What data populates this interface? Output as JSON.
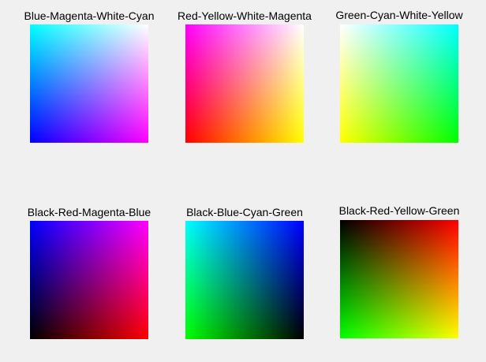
{
  "figure": {
    "background": "#f0f0f0",
    "panels": [
      {
        "title": "Blue-Magenta-White-Cyan",
        "corners": {
          "top_left": "#00ffff",
          "top_right": "#ffffff",
          "bottom_left": "#0000ff",
          "bottom_right": "#ff00ff"
        }
      },
      {
        "title": "Red-Yellow-White-Magenta",
        "corners": {
          "top_left": "#ff00ff",
          "top_right": "#ffffff",
          "bottom_left": "#ff0000",
          "bottom_right": "#ffff00"
        }
      },
      {
        "title": "Green-Cyan-White-Yellow",
        "corners": {
          "top_left": "#ffffff",
          "top_right": "#00ffff",
          "bottom_left": "#ffff00",
          "bottom_right": "#00ff00"
        }
      },
      {
        "title": "Black-Red-Magenta-Blue",
        "corners": {
          "top_left": "#0000ff",
          "top_right": "#ff00ff",
          "bottom_left": "#000000",
          "bottom_right": "#ff0000"
        }
      },
      {
        "title": "Black-Blue-Cyan-Green",
        "corners": {
          "top_left": "#00ffff",
          "top_right": "#0000ff",
          "bottom_left": "#00ff00",
          "bottom_right": "#000000"
        }
      },
      {
        "title": "Black-Red-Yellow-Green",
        "corners": {
          "top_left": "#000000",
          "top_right": "#ff0000",
          "bottom_left": "#00ff00",
          "bottom_right": "#ffff00"
        }
      }
    ]
  }
}
